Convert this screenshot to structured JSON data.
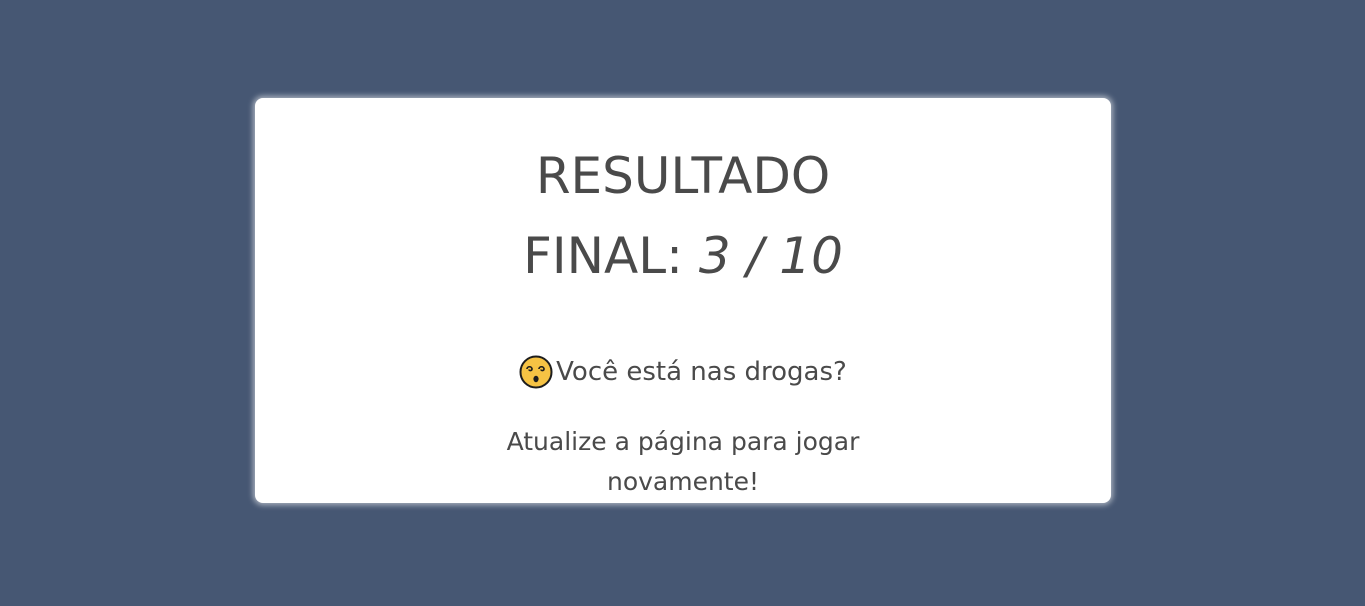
{
  "result": {
    "title_line1": "RESULTADO",
    "title_line2_label": "FINAL:",
    "score": "3 / 10",
    "message": "Você está nas drogas?",
    "message_icon": "dizzy-face-emoji",
    "hint": "Atualize a página para jogar novamente!"
  },
  "colors": {
    "background": "#465773",
    "card": "#ffffff",
    "text": "#4a4a4a",
    "emoji_face": "#f6c344"
  }
}
